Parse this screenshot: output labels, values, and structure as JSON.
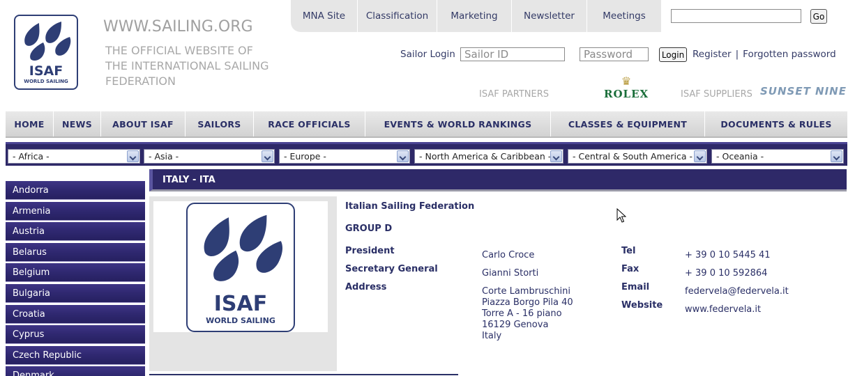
{
  "header": {
    "site_url": "WWW.SAILING.ORG",
    "tagline": "THE OFFICIAL WEBSITE OF THE INTERNATIONAL SAILING FEDERATION",
    "logo_text": "ISAF",
    "logo_subtext": "WORLD SAILING"
  },
  "top_tabs": [
    "MNA Site",
    "Classification",
    "Marketing",
    "Newsletter",
    "Meetings"
  ],
  "search": {
    "value": "",
    "go_label": "Go"
  },
  "login": {
    "label": "Sailor Login",
    "sailor_id_placeholder": "Sailor ID",
    "password_placeholder": "Password",
    "button": "Login",
    "register": "Register",
    "separator": "|",
    "forgotten": "Forgotten password"
  },
  "sponsors": {
    "partners_label": "ISAF PARTNERS",
    "rolex": "ROLEX",
    "suppliers_label": "ISAF SUPPLIERS",
    "supplier_logo_text": "SUNSET NINE"
  },
  "main_nav": [
    "HOME",
    "NEWS",
    "ABOUT ISAF",
    "SAILORS",
    "RACE OFFICIALS",
    "EVENTS & WORLD RANKINGS",
    "CLASSES & EQUIPMENT",
    "DOCUMENTS & RULES"
  ],
  "regions": [
    "- Africa -",
    "- Asia -",
    "- Europe -",
    "- North America & Caribbean -",
    "- Central & South America -",
    "- Oceania -"
  ],
  "sidebar": [
    "Andorra",
    "Armenia",
    "Austria",
    "Belarus",
    "Belgium",
    "Bulgaria",
    "Croatia",
    "Cyprus",
    "Czech Republic",
    "Denmark"
  ],
  "content": {
    "header": "ITALY - ITA",
    "federation": "Italian Sailing Federation",
    "group": "GROUP D",
    "president_label": "President",
    "president": "Carlo Croce",
    "secgen_label": "Secretary General",
    "secgen": "Gianni Storti",
    "address_label": "Address",
    "address": [
      "Corte Lambruschini",
      "Piazza Borgo Pila 40",
      "Torre A - 16 piano",
      "16129 Genova",
      "Italy"
    ],
    "tel_label": "Tel",
    "tel": "+ 39 0 10 5445 41",
    "fax_label": "Fax",
    "fax": "+ 39 0 10 592864",
    "email_label": "Email",
    "email": "federvela@federvela.it",
    "website_label": "Website",
    "website": "www.federvela.it"
  },
  "colors": {
    "brand_purple": "#2e2968",
    "text_navy": "#2a2f66",
    "logo_blue": "#2e3e75",
    "rolex_green": "#1a6e3a"
  }
}
